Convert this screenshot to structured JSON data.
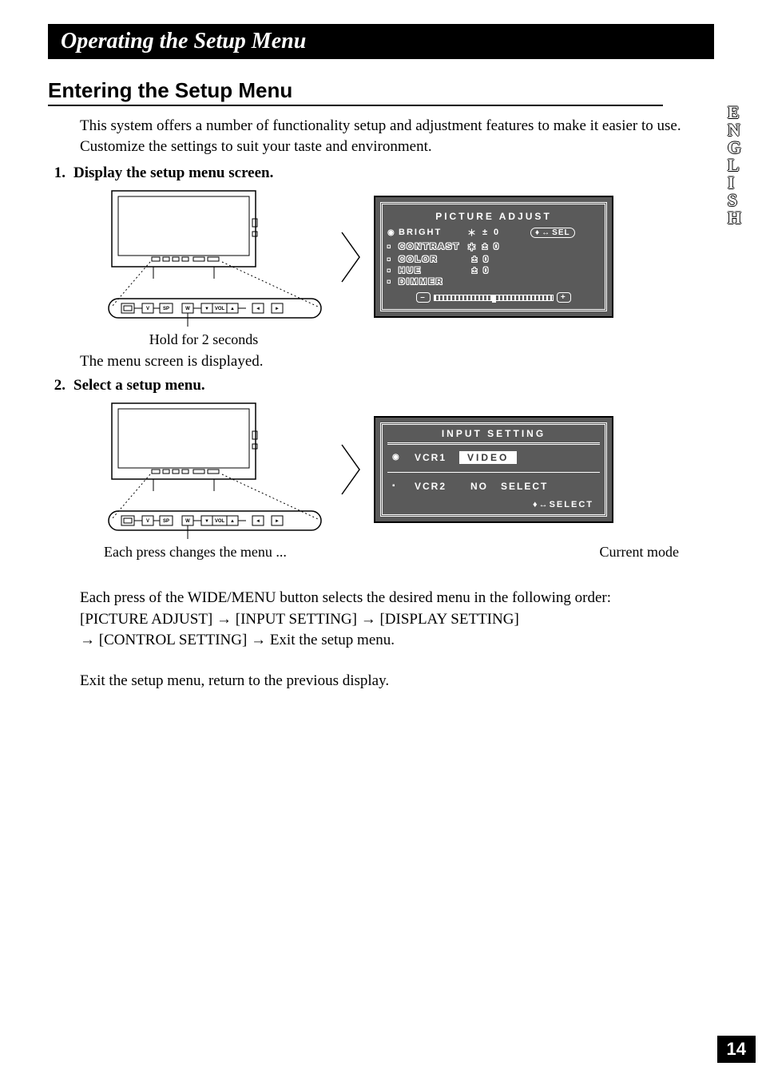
{
  "title": "Operating the Setup Menu",
  "side_tab": "ENGLISH",
  "page_number": "14",
  "section_heading": "Entering the Setup Menu",
  "intro": "This system offers a number of functionality setup and adjustment features to make it easier to use. Customize the settings to suit your taste and environment.",
  "steps": {
    "1": {
      "num": "1.",
      "text": "Display the setup menu screen."
    },
    "2": {
      "num": "2.",
      "text": "Select a setup menu."
    }
  },
  "fig1": {
    "hold_caption": "Hold for 2 seconds",
    "result_line": "The menu screen is displayed.",
    "osd_title": "PICTURE ADJUST",
    "rows": [
      {
        "label": "BRIGHT",
        "mark": "＊",
        "sign": "±",
        "val": "0",
        "active": true
      },
      {
        "label": "CONTRAST",
        "mark": "＊",
        "sign": "±",
        "val": "0",
        "active": false
      },
      {
        "label": "COLOR",
        "mark": "",
        "sign": "±",
        "val": "0",
        "active": false
      },
      {
        "label": "HUE",
        "mark": "",
        "sign": "±",
        "val": "0",
        "active": false
      },
      {
        "label": "DIMMER",
        "mark": "",
        "sign": "",
        "val": "",
        "active": false
      }
    ],
    "sel_badge": "SEL",
    "minus": "–",
    "plus": "+"
  },
  "fig2": {
    "caption_left": "Each press changes the menu ...",
    "caption_right": "Current mode",
    "osd_title": "INPUT SETTING",
    "r1_label": "VCR1",
    "r1_value": "VIDEO",
    "r2_label": "VCR2",
    "r2_text1": "NO",
    "r2_text2": "SELECT",
    "sel_hint": "SELECT"
  },
  "body": {
    "p1": "Each press of the WIDE/MENU button selects the desired menu in the following order:",
    "seq": [
      "[PICTURE ADJUST]",
      "[INPUT SETTING]",
      "[DISPLAY SETTING]",
      "[CONTROL SETTING]",
      "Exit the setup menu."
    ],
    "arrow": "→",
    "p2": "Exit the setup menu, return to the previous display."
  },
  "remote_buttons": [
    "V",
    "SP",
    "W",
    "▼",
    "VOL",
    "▲",
    "◄",
    "►"
  ]
}
